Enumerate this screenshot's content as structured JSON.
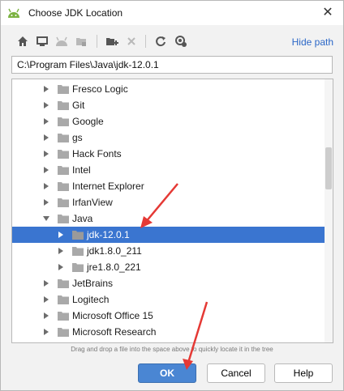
{
  "window": {
    "title": "Choose JDK Location",
    "close_glyph": "✕"
  },
  "toolbar": {
    "icons": [
      "home-icon",
      "desktop-icon",
      "project-icon",
      "module-icon",
      "new-folder-icon",
      "delete-icon",
      "refresh-icon",
      "show-hidden-icon"
    ],
    "hide_path_label": "Hide path"
  },
  "path": {
    "value": "C:\\Program Files\\Java\\jdk-12.0.1"
  },
  "tree": {
    "rows": [
      {
        "label": "Fresco Logic",
        "expanded": false,
        "selected": false,
        "level": 0
      },
      {
        "label": "Git",
        "expanded": false,
        "selected": false,
        "level": 0
      },
      {
        "label": "Google",
        "expanded": false,
        "selected": false,
        "level": 0
      },
      {
        "label": "gs",
        "expanded": false,
        "selected": false,
        "level": 0
      },
      {
        "label": "Hack Fonts",
        "expanded": false,
        "selected": false,
        "level": 0
      },
      {
        "label": "Intel",
        "expanded": false,
        "selected": false,
        "level": 0
      },
      {
        "label": "Internet Explorer",
        "expanded": false,
        "selected": false,
        "level": 0
      },
      {
        "label": "IrfanView",
        "expanded": false,
        "selected": false,
        "level": 0
      },
      {
        "label": "Java",
        "expanded": true,
        "selected": false,
        "level": 0
      },
      {
        "label": "jdk-12.0.1",
        "expanded": false,
        "selected": true,
        "level": 1
      },
      {
        "label": "jdk1.8.0_211",
        "expanded": false,
        "selected": false,
        "level": 1
      },
      {
        "label": "jre1.8.0_221",
        "expanded": false,
        "selected": false,
        "level": 1
      },
      {
        "label": "JetBrains",
        "expanded": false,
        "selected": false,
        "level": 0
      },
      {
        "label": "Logitech",
        "expanded": false,
        "selected": false,
        "level": 0
      },
      {
        "label": "Microsoft Office 15",
        "expanded": false,
        "selected": false,
        "level": 0
      },
      {
        "label": "Microsoft Research",
        "expanded": false,
        "selected": false,
        "level": 0
      }
    ]
  },
  "hint": "Drag and drop a file into the space above to quickly locate it in the tree",
  "buttons": {
    "ok": "OK",
    "cancel": "Cancel",
    "help": "Help"
  },
  "colors": {
    "selection": "#3a75d0",
    "ok_button": "#4a86d3",
    "link": "#2b67c7",
    "annotation_arrow": "#e53935",
    "android_green": "#7cb342"
  }
}
